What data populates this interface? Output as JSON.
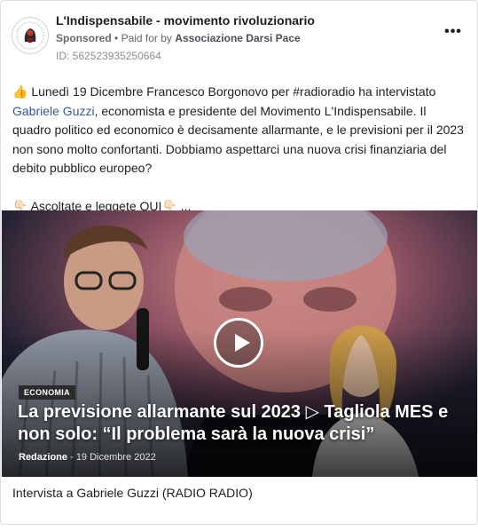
{
  "post": {
    "page_name": "L'Indispensabile - movimento rivoluzionario",
    "sponsored_label": "Sponsored",
    "separator": "•",
    "paid_by_prefix": "Paid for by",
    "payer": "Associazione Darsi Pace",
    "ad_id": "ID: 562523935250664",
    "more_label": "•••"
  },
  "body": {
    "line1_emoji": "👍",
    "line1_text": "Lunedì 19 Dicembre Francesco Borgonovo per #radioradio ha intervistato",
    "link_name": "Gabriele Guzzi",
    "line2_rest": ", economista e presidente del Movimento L'Indispensabile. Il quadro politico ed economico è decisamente allarmante, e le previsioni per il 2023 non sono molto confortanti. Dobbiamo aspettarci una nuova crisi finanziaria del debito pubblico europeo?",
    "cta_emoji_left": "👇🏻",
    "cta_text": "Ascoltate e leggete QUI",
    "cta_emoji_right": "👇🏻",
    "cta_ellipsis": "..."
  },
  "media": {
    "tag": "ECONOMIA",
    "headline": "La previsione allarmante sul 2023 ▷ Tagliola MES e non solo: “Il problema sarà la nuova crisi”",
    "author": "Redazione",
    "date_sep": "-",
    "date": "19 Dicembre 2022"
  },
  "caption": "Intervista a Gabriele Guzzi (RADIO RADIO)",
  "colors": {
    "link": "#385898",
    "secondary_text": "#65676b",
    "border": "#dddfe2"
  }
}
